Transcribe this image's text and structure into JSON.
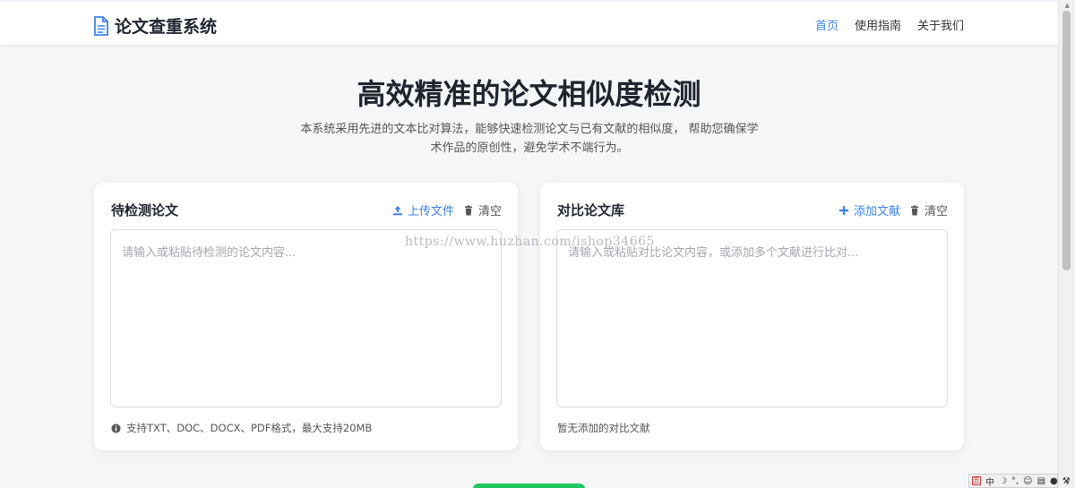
{
  "header": {
    "brand": "论文查重系统",
    "brand_icon": "document-icon",
    "nav": [
      {
        "label": "首页",
        "active": true
      },
      {
        "label": "使用指南",
        "active": false
      },
      {
        "label": "关于我们",
        "active": false
      }
    ]
  },
  "hero": {
    "title": "高效精准的论文相似度检测",
    "description": "本系统采用先进的文本比对算法，能够快速检测论文与已有文献的相似度， 帮助您确保学术作品的原创性，避免学术不端行为。"
  },
  "left_card": {
    "title": "待检测论文",
    "upload_label": "上传文件",
    "upload_icon": "upload-icon",
    "clear_label": "清空",
    "clear_icon": "trash-icon",
    "placeholder": "请输入或粘贴待检测的论文内容...",
    "value": "",
    "hint_icon": "info-icon",
    "hint": "支持TXT、DOC、DOCX、PDF格式，最大支持20MB"
  },
  "right_card": {
    "title": "对比论文库",
    "add_label": "添加文献",
    "add_icon": "plus-icon",
    "clear_label": "清空",
    "clear_icon": "trash-icon",
    "placeholder": "请输入或粘贴对比论文内容，或添加多个文献进行比对...",
    "value": "",
    "status": "暂无添加的对比文献"
  },
  "watermark": "https://www.huzhan.com/ishop34665",
  "ime": {
    "label": "中"
  },
  "colors": {
    "accent": "#3b82f6",
    "primary_button": "#22c55e",
    "background": "#f5f6f8",
    "card": "#ffffff"
  }
}
